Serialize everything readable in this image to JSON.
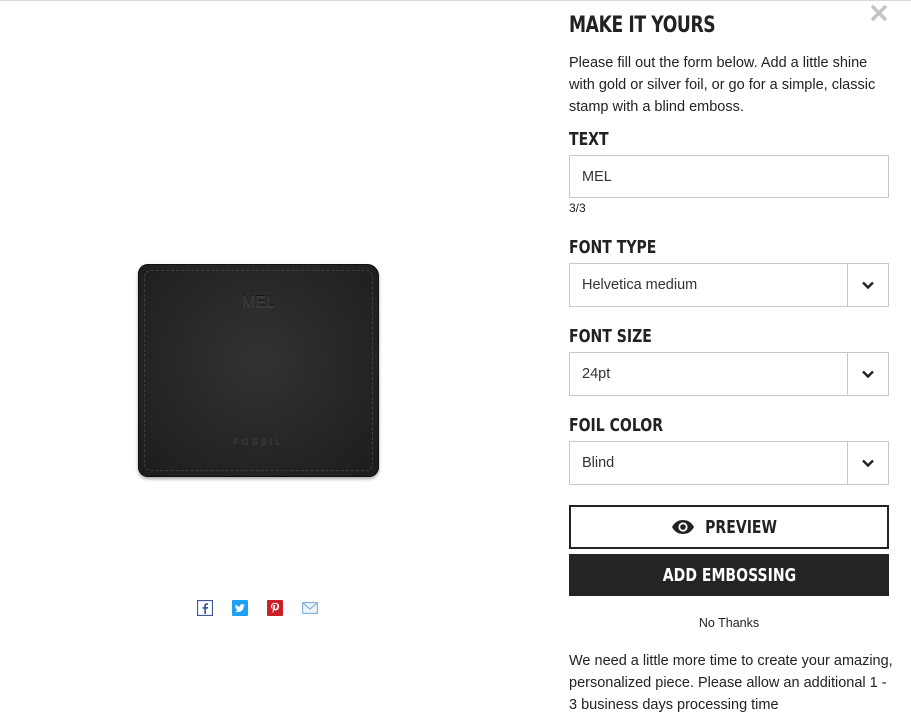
{
  "modal": {
    "title": "MAKE IT YOURS",
    "intro": "Please fill out the form below. Add a little shine with gold or silver foil, or go for a simple, classic stamp with a blind emboss.",
    "close_icon": "close-icon"
  },
  "product": {
    "emboss_text": "MEL",
    "brand_mark": "FOSSIL",
    "color": "#262626"
  },
  "share": {
    "icons": [
      "facebook-icon",
      "twitter-icon",
      "pinterest-icon",
      "email-icon"
    ],
    "colors": {
      "facebook": "#3b5998",
      "twitter": "#1da1f2",
      "pinterest": "#cb2027",
      "email": "#8ab4d8"
    }
  },
  "form": {
    "text": {
      "label": "TEXT",
      "value": "MEL",
      "counter": "3/3"
    },
    "font_type": {
      "label": "FONT TYPE",
      "selected": "Helvetica medium"
    },
    "font_size": {
      "label": "FONT SIZE",
      "selected": "24pt"
    },
    "foil_color": {
      "label": "FOIL COLOR",
      "selected": "Blind"
    }
  },
  "actions": {
    "preview_label": "PREVIEW",
    "add_label": "ADD EMBOSSING",
    "no_thanks_label": "No Thanks"
  },
  "notice": "We need a little more time to create your amazing, personalized piece. Please allow an additional 1 - 3 business days processing time"
}
